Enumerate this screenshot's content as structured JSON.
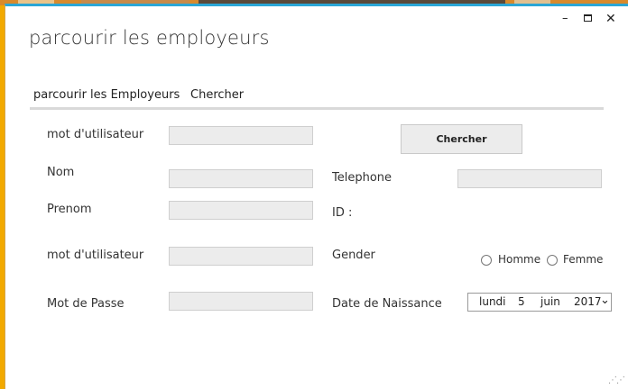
{
  "window": {
    "title": "parcourir les employeurs",
    "controls": {
      "minimize": "–",
      "close": "✕"
    }
  },
  "tabs": [
    {
      "label": "parcourir les Employeurs",
      "active": false
    },
    {
      "label": "Chercher",
      "active": true
    }
  ],
  "form": {
    "username_search_label": "mot d'utilisateur",
    "search_button": "Chercher",
    "nom_label": "Nom",
    "telephone_label": "Telephone",
    "prenom_label": "Prenom",
    "id_label": "ID :",
    "username_label": "mot d'utilisateur",
    "gender_label": "Gender",
    "gender_options": [
      "Homme",
      "Femme"
    ],
    "password_label": "Mot de Passe",
    "birthdate_label": "Date de Naissance",
    "birthdate": {
      "weekday": "lundi",
      "day": "5",
      "month": "juin",
      "year": "2017",
      "dropdown": "⌄"
    }
  },
  "colors": {
    "accent": "#2aa6d6",
    "desktop": "#f2a900"
  },
  "icons": {
    "minimize": "minimize-icon",
    "maximize": "maximize-icon",
    "close": "close-icon",
    "dropdown": "chevron-down-icon",
    "grip": "resize-grip-icon"
  }
}
